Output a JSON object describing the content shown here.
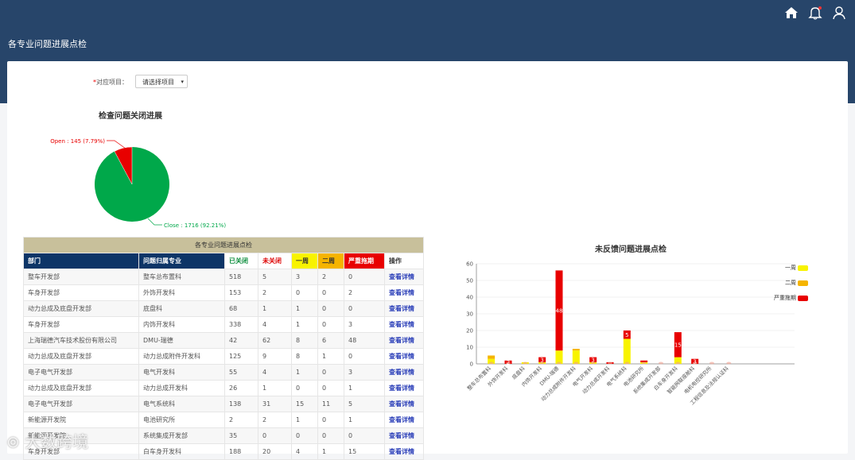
{
  "header": {
    "title": "各专业问题进展点检"
  },
  "filter": {
    "required_mark": "*",
    "label": "对应项目：",
    "select_value": "请选择项目",
    "arrow": "▾"
  },
  "pie": {
    "title": "检查问题关闭进展",
    "open_label": "Open : 145 (7.79%)",
    "close_label": "Close : 1716 (92.21%)"
  },
  "table": {
    "caption": "各专业问题进展点检",
    "headers": [
      "部门",
      "问题归属专业",
      "已关闭",
      "未关闭",
      "一周",
      "二周",
      "严重拖期",
      "操作"
    ],
    "rows": [
      [
        "整车开发部",
        "整车总布置科",
        "518",
        "5",
        "3",
        "2",
        "0",
        "查看详情"
      ],
      [
        "车身开发部",
        "外饰开发科",
        "153",
        "2",
        "0",
        "0",
        "2",
        "查看详情"
      ],
      [
        "动力总成及底盘开发部",
        "底盘科",
        "68",
        "1",
        "1",
        "0",
        "0",
        "查看详情"
      ],
      [
        "车身开发部",
        "内饰开发科",
        "338",
        "4",
        "1",
        "0",
        "3",
        "查看详情"
      ],
      [
        "上海瑞德汽车技术股份有限公司",
        "DMU-瑞德",
        "42",
        "62",
        "8",
        "6",
        "48",
        "查看详情"
      ],
      [
        "动力总成及底盘开发部",
        "动力总成附件开发科",
        "125",
        "9",
        "8",
        "1",
        "0",
        "查看详情"
      ],
      [
        "电子电气开发部",
        "电气开发科",
        "55",
        "4",
        "1",
        "0",
        "3",
        "查看详情"
      ],
      [
        "动力总成及底盘开发部",
        "动力总成开发科",
        "26",
        "1",
        "0",
        "0",
        "1",
        "查看详情"
      ],
      [
        "电子电气开发部",
        "电气系统科",
        "138",
        "31",
        "15",
        "11",
        "5",
        "查看详情"
      ],
      [
        "新能源开发院",
        "电池研究所",
        "2",
        "2",
        "1",
        "0",
        "1",
        "查看详情"
      ],
      [
        "新能源开发院",
        "系统集成开发部",
        "35",
        "0",
        "0",
        "0",
        "0",
        "查看详情"
      ],
      [
        "车身开发部",
        "白车身开发科",
        "188",
        "20",
        "4",
        "1",
        "15",
        "查看详情"
      ]
    ]
  },
  "chart_data": [
    {
      "type": "pie",
      "title": "检查问题关闭进展",
      "slices": [
        {
          "name": "Open",
          "value": 145,
          "percent": 7.79,
          "color": "#e80000"
        },
        {
          "name": "Close",
          "value": 1716,
          "percent": 92.21,
          "color": "#00a84a"
        }
      ]
    },
    {
      "type": "bar",
      "stacked": true,
      "title": "未反馈问题进展点检",
      "ylim": [
        0,
        60
      ],
      "yticks": [
        "0",
        "10",
        "20",
        "30",
        "40",
        "50",
        "60"
      ],
      "categories": [
        "整车总布置科",
        "外饰开发科",
        "底盘科",
        "内饰开发科",
        "DMU-瑞德",
        "动力总成附件开发科",
        "电气开发科",
        "动力总成开发科",
        "电气系统科",
        "电池研究所",
        "系统集成开发部",
        "白车身开发科",
        "智能网联座舱科",
        "电机电控研究所",
        "工程信息及法规认证科"
      ],
      "series": [
        {
          "name": "一周",
          "color": "#f8f300",
          "values": [
            3,
            0,
            1,
            1,
            8,
            8,
            1,
            0,
            15,
            1,
            0,
            4,
            0,
            0,
            0
          ]
        },
        {
          "name": "二周",
          "color": "#f5b400",
          "values": [
            2,
            0,
            0,
            0,
            0,
            1,
            0,
            0,
            0,
            0,
            0,
            0,
            0,
            0,
            0
          ]
        },
        {
          "name": "严重拖期",
          "color": "#e80000",
          "values": [
            0,
            2,
            0,
            3,
            48,
            0,
            3,
            1,
            5,
            1,
            0,
            15,
            3,
            0,
            0
          ]
        }
      ],
      "bar_labels": [
        {
          "category": "外饰开发科",
          "text": "2"
        },
        {
          "category": "内饰开发科",
          "text": "3"
        },
        {
          "category": "DMU-瑞德",
          "text": "48"
        },
        {
          "category": "电气开发科",
          "text": "3"
        },
        {
          "category": "电气系统科",
          "text": "5"
        },
        {
          "category": "白车身开发科",
          "text": "15"
        },
        {
          "category": "智能网联座舱科",
          "text": "3"
        }
      ],
      "legend_position": "top-right"
    }
  ]
}
